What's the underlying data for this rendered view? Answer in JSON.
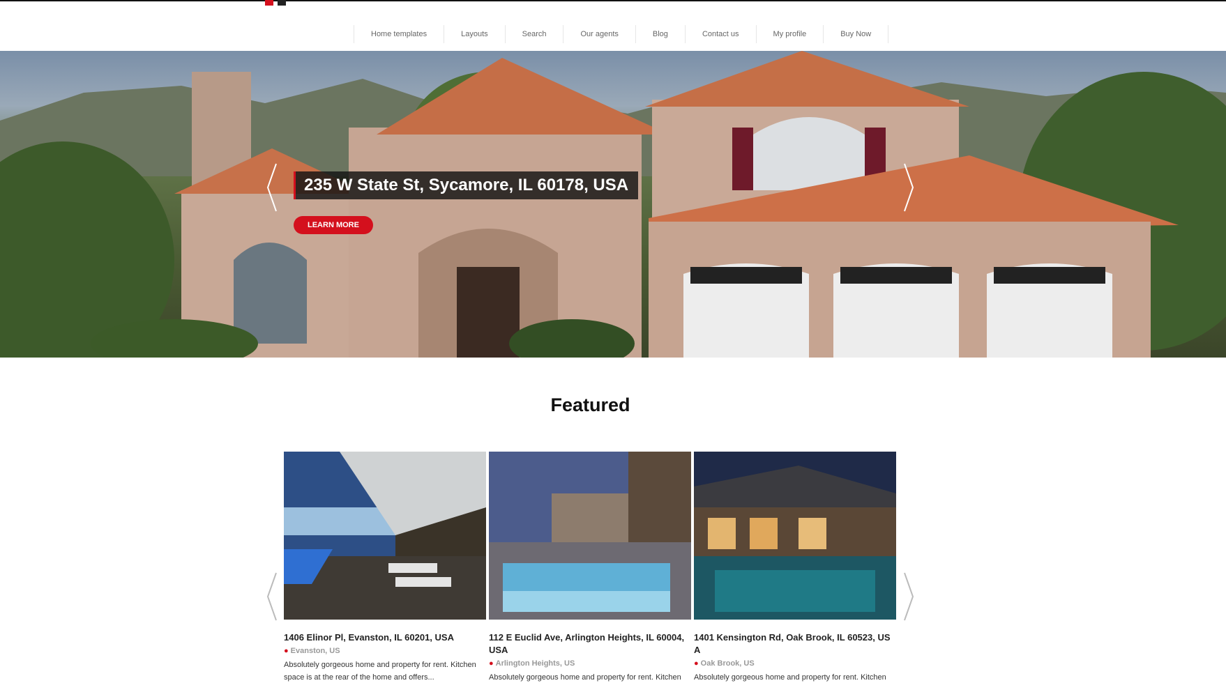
{
  "nav": {
    "items": [
      {
        "label": "Home templates"
      },
      {
        "label": "Layouts"
      },
      {
        "label": "Search"
      },
      {
        "label": "Our agents"
      },
      {
        "label": "Blog"
      },
      {
        "label": "Contact us"
      },
      {
        "label": "My profile"
      },
      {
        "label": "Buy Now"
      }
    ]
  },
  "hero": {
    "title": "235 W State St, Sycamore, IL 60178, USA",
    "button_label": "LEARN MORE"
  },
  "featured": {
    "heading": "Featured",
    "cards": [
      {
        "title": "1406 Elinor Pl, Evanston, IL 60201, USA",
        "location": "Evanston, US",
        "description": "Absolutely gorgeous home and property for rent. Kitchen space is at the rear of the home and offers..."
      },
      {
        "title": "112 E Euclid Ave, Arlington Heights, IL 60004, USA",
        "location": "Arlington Heights, US",
        "description": "Absolutely gorgeous home and property for rent. Kitchen"
      },
      {
        "title": "1401 Kensington Rd, Oak Brook, IL 60523, US A",
        "location": "Oak Brook, US",
        "description": "Absolutely gorgeous home and property for rent. Kitchen"
      }
    ]
  },
  "colors": {
    "accent": "#d4101d",
    "nav_text": "#666666",
    "heading": "#111111"
  },
  "icons": {
    "location": "map-pin-icon",
    "prev": "chevron-left-icon",
    "next": "chevron-right-icon"
  }
}
